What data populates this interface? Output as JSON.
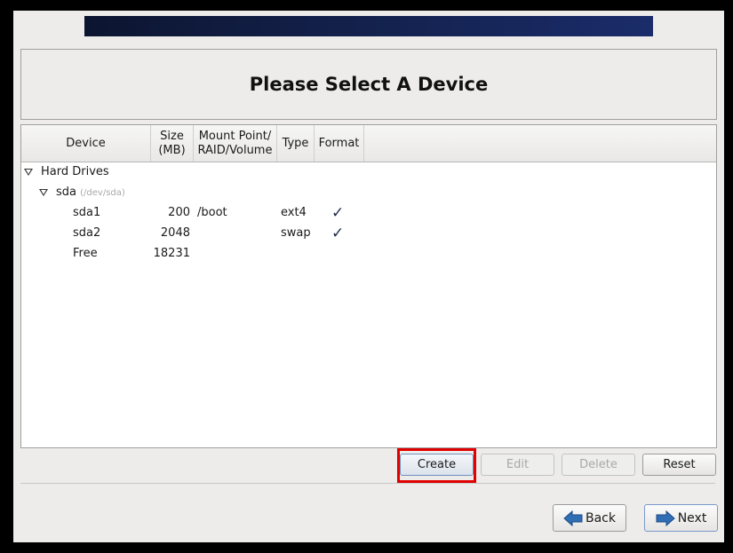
{
  "page": {
    "title": "Please Select A Device"
  },
  "table": {
    "columns": [
      "Device",
      "Size\n(MB)",
      "Mount Point/\nRAID/Volume",
      "Type",
      "Format"
    ],
    "column_labels": {
      "device": "Device",
      "size_line1": "Size",
      "size_line2": "(MB)",
      "mount_line1": "Mount Point/",
      "mount_line2": "RAID/Volume",
      "type": "Type",
      "format": "Format"
    },
    "groups": [
      {
        "label": "Hard Drives",
        "expanded": true,
        "disks": [
          {
            "name": "sda",
            "path": "(/dev/sda)",
            "expanded": true,
            "rows": [
              {
                "device": "sda1",
                "size": "200",
                "mount": "/boot",
                "type": "ext4",
                "format": true
              },
              {
                "device": "sda2",
                "size": "2048",
                "mount": "",
                "type": "swap",
                "format": true
              },
              {
                "device": "Free",
                "size": "18231",
                "mount": "",
                "type": "",
                "format": false
              }
            ]
          }
        ]
      }
    ],
    "check_glyph": "✓"
  },
  "actions": {
    "create": "Create",
    "edit": "Edit",
    "delete": "Delete",
    "reset": "Reset"
  },
  "nav": {
    "back": "Back",
    "next": "Next"
  },
  "colors": {
    "highlight": "#e00000",
    "banner_start": "#0c1530",
    "banner_end": "#1a2c6a",
    "arrow_icon": "#2f6db5"
  }
}
